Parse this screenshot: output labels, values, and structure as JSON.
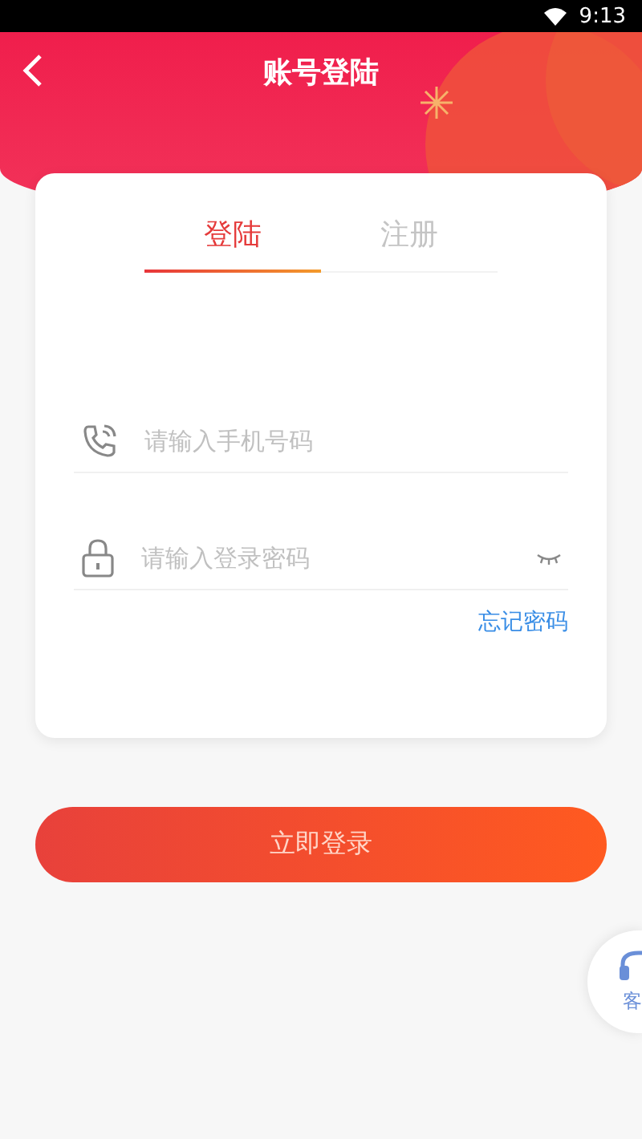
{
  "status_bar": {
    "time": "9:13"
  },
  "header": {
    "title": "账号登陆"
  },
  "tabs": [
    {
      "label": "登陆",
      "selected": true
    },
    {
      "label": "注册",
      "selected": false
    }
  ],
  "fields": [
    {
      "kind": "phone",
      "placeholder": "请输入手机号码"
    },
    {
      "kind": "password",
      "placeholder": "请输入登录密码"
    }
  ],
  "forgot_link": "忘记密码",
  "login_button": "立即登录",
  "service_button": {
    "label": "客"
  }
}
